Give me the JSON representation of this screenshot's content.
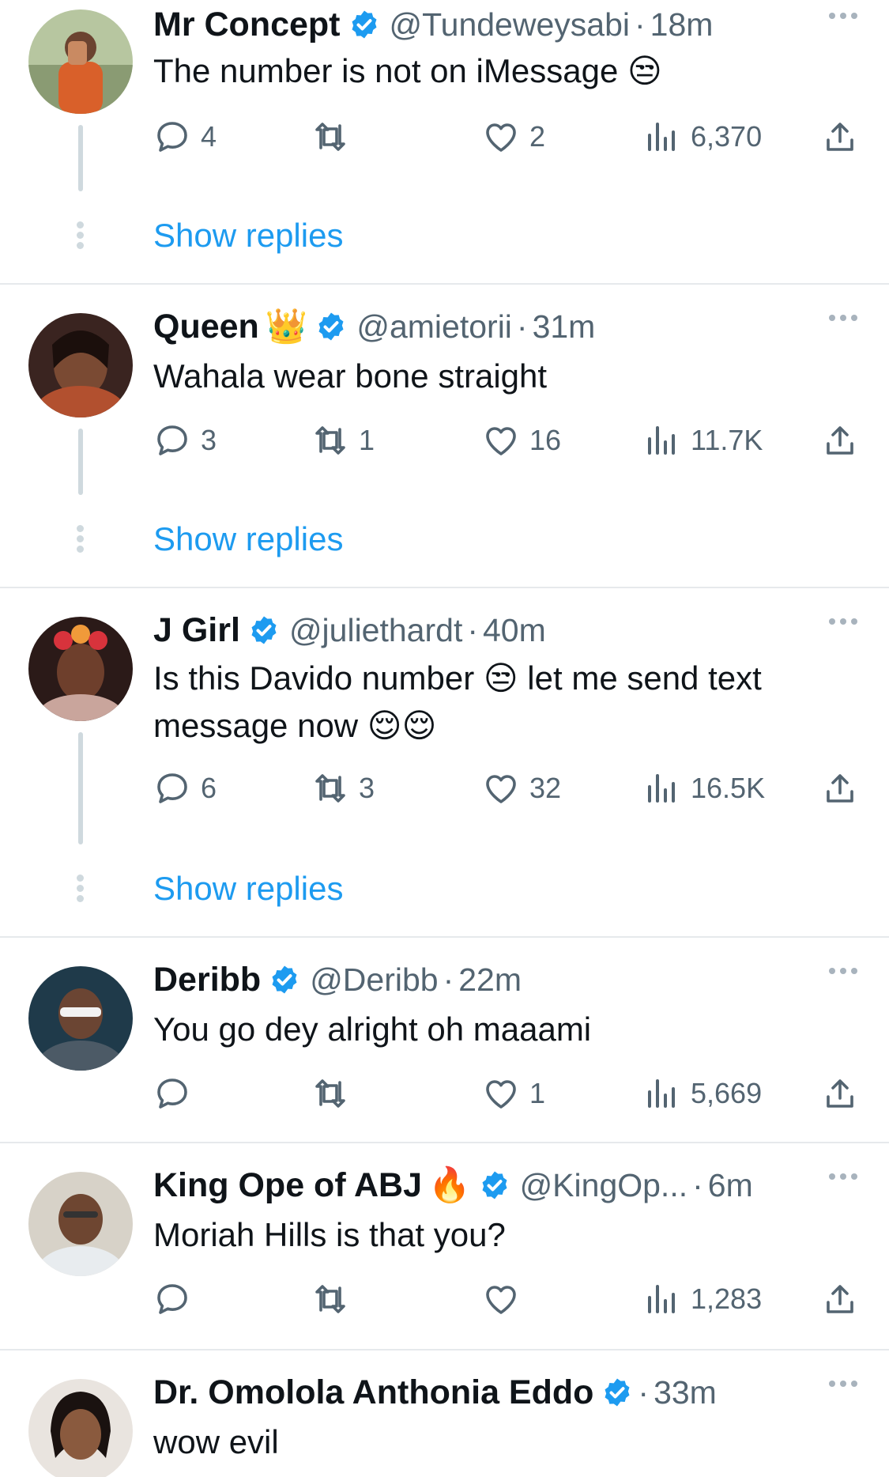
{
  "colors": {
    "accent": "#1d9bf0",
    "muted": "#536471",
    "text": "#0f1419",
    "verified": "#1d9bf0"
  },
  "tweets": [
    {
      "name": "Mr Concept",
      "name_emoji": "",
      "verified": true,
      "handle": "@Tundeweysabi",
      "time": "18m",
      "text": "The number is not on iMessage 😒",
      "replies": "4",
      "retweets": "",
      "likes": "2",
      "views": "6,370",
      "show_replies": "Show replies"
    },
    {
      "name": "Queen",
      "name_emoji": "👑",
      "verified": true,
      "handle": "@amietorii",
      "time": "31m",
      "text": "Wahala wear bone straight",
      "replies": "3",
      "retweets": "1",
      "likes": "16",
      "views": "11.7K",
      "show_replies": "Show replies"
    },
    {
      "name": "J Girl",
      "name_emoji": "",
      "verified": true,
      "handle": "@juliethardt",
      "time": "40m",
      "text": "Is this Davido number 😒 let me send text message now 😌😌",
      "replies": "6",
      "retweets": "3",
      "likes": "32",
      "views": "16.5K",
      "show_replies": "Show replies"
    },
    {
      "name": "Deribb",
      "name_emoji": "",
      "verified": true,
      "handle": "@Deribb",
      "time": "22m",
      "text": "You go dey alright oh maaami",
      "replies": "",
      "retweets": "",
      "likes": "1",
      "views": "5,669"
    },
    {
      "name": "King Ope of ABJ",
      "name_emoji": "🔥",
      "verified": true,
      "handle": "@KingOp...",
      "time": "6m",
      "text": "Moriah Hills is that you?",
      "replies": "",
      "retweets": "",
      "likes": "",
      "views": "1,283"
    },
    {
      "name": "Dr. Omolola Anthonia Eddo",
      "name_emoji": "",
      "verified": true,
      "handle": "",
      "time": "33m",
      "text": "wow evil"
    }
  ],
  "icons": [
    "reply-icon",
    "retweet-icon",
    "like-icon",
    "views-icon",
    "share-icon",
    "verified-badge-icon",
    "more-icon"
  ]
}
